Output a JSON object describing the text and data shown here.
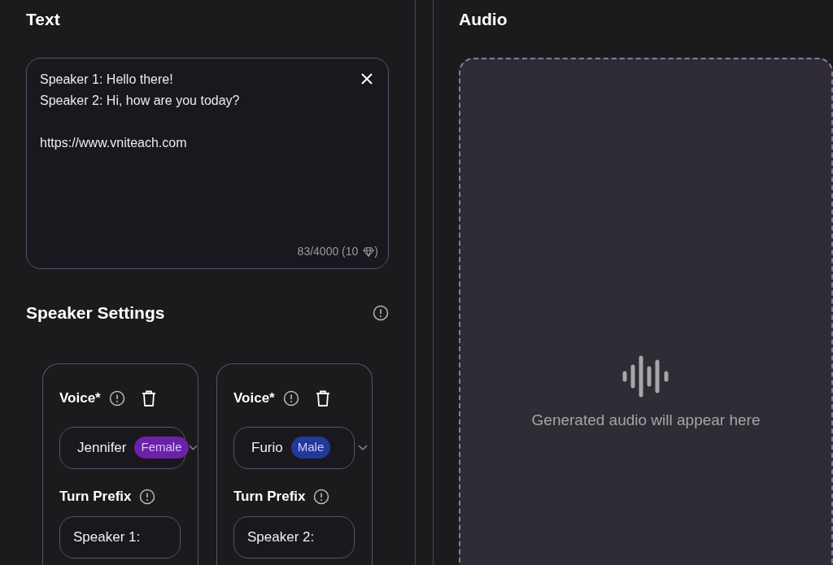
{
  "text_section": {
    "title": "Text",
    "value": "Speaker 1: Hello there!\nSpeaker 2: Hi, how are you today?\n\nhttps://www.vniteach.com",
    "counter_prefix": "83/4000 (10",
    "counter_suffix": ")"
  },
  "speaker_settings": {
    "title": "Speaker Settings",
    "speakers": [
      {
        "voice_label": "Voice*",
        "voice": "Jennifer",
        "gender": "Female",
        "color": "#6b21a8",
        "prefix_label": "Turn Prefix",
        "prefix": "Speaker 1:"
      },
      {
        "voice_label": "Voice*",
        "voice": "Furio",
        "gender": "Male",
        "color": "#1e3a9a",
        "prefix_label": "Turn Prefix",
        "prefix": "Speaker 2:"
      }
    ]
  },
  "audio_section": {
    "title": "Audio",
    "placeholder": "Generated audio will appear here"
  }
}
